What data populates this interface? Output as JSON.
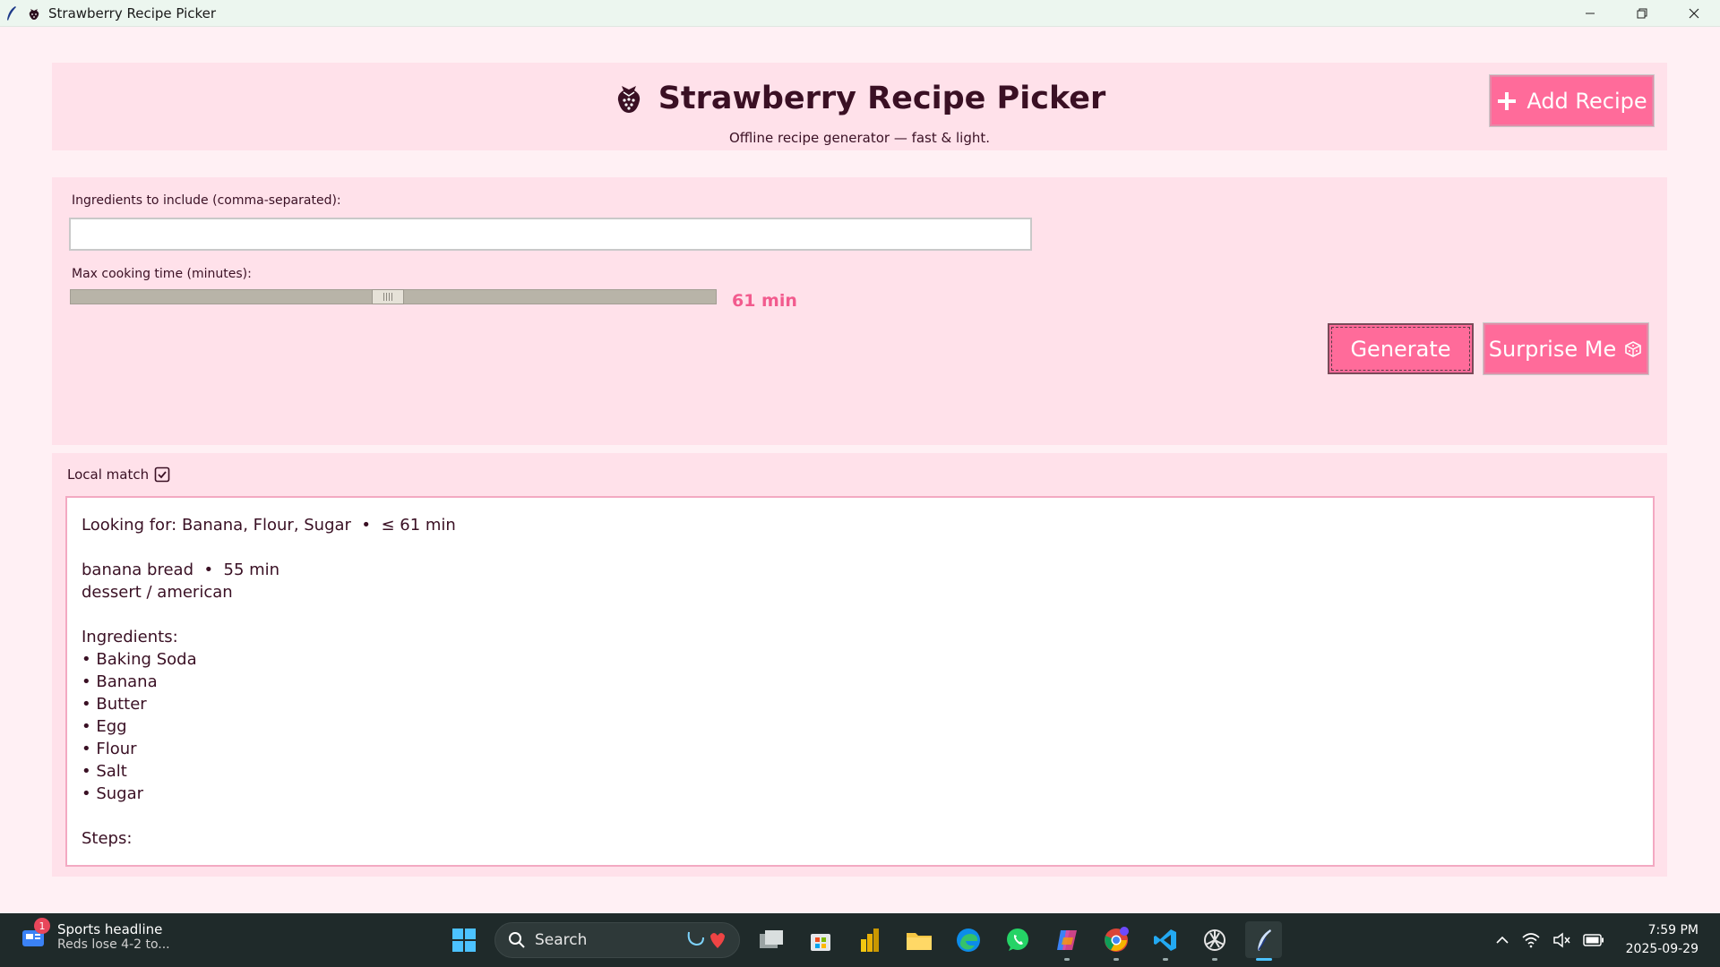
{
  "window": {
    "title": "Strawberry Recipe Picker"
  },
  "header": {
    "title": "Strawberry Recipe Picker",
    "subtitle": "Offline recipe generator — fast & light.",
    "add_recipe_label": "Add Recipe"
  },
  "controls": {
    "ingredients_label": "Ingredients to include (comma-separated):",
    "ingredients_value": "",
    "time_label": "Max cooking time (minutes):",
    "time_value_text": "61 min",
    "time_fraction": 0.49,
    "generate_label": "Generate",
    "surprise_label": "Surprise Me"
  },
  "results": {
    "local_match_label": "Local match",
    "local_match_checked": true,
    "lines": [
      "Looking for: Banana, Flour, Sugar  •  ≤ 61 min",
      "",
      "banana bread  •  55 min",
      "dessert / american",
      "",
      "Ingredients:",
      "• Baking Soda",
      "• Banana",
      "• Butter",
      "• Egg",
      "• Flour",
      "• Salt",
      "• Sugar",
      "",
      "Steps:"
    ]
  },
  "taskbar": {
    "news_headline": "Sports headline",
    "news_sub": "Reds lose 4-2 to...",
    "news_badge": "1",
    "search_label": "Search",
    "time": "7:59 PM",
    "date": "2025-09-29"
  },
  "colors": {
    "accent": "#ff6b9a",
    "card": "#ffe1ea",
    "background": "#fff0f4",
    "text": "#3a1024",
    "slider_value": "#f25b8e"
  }
}
